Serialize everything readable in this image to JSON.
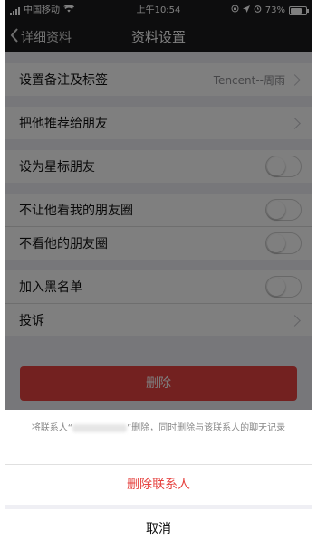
{
  "status_bar": {
    "carrier": "中国移动",
    "time": "上午10:54",
    "battery": "73%"
  },
  "nav": {
    "back_label": "详细资料",
    "title": "资料设置"
  },
  "settings": {
    "remark_label": "设置备注及标签",
    "remark_value": "Tencent--周雨",
    "recommend_label": "把他推荐给朋友",
    "star_label": "设为星标朋友",
    "hide_moments_from_label": "不让他看我的朋友圈",
    "hide_his_moments_label": "不看他的朋友圈",
    "blacklist_label": "加入黑名单",
    "complain_label": "投诉"
  },
  "delete_button_label": "删除",
  "action_sheet": {
    "message_prefix": "将联系人“",
    "message_suffix": "”删除，同时删除与该联系人的聊天记录",
    "delete_contact_label": "删除联系人",
    "cancel_label": "取消"
  },
  "colors": {
    "danger": "#e64340",
    "nav_bg": "#1a1a1d",
    "group_bg": "#efeff4"
  }
}
